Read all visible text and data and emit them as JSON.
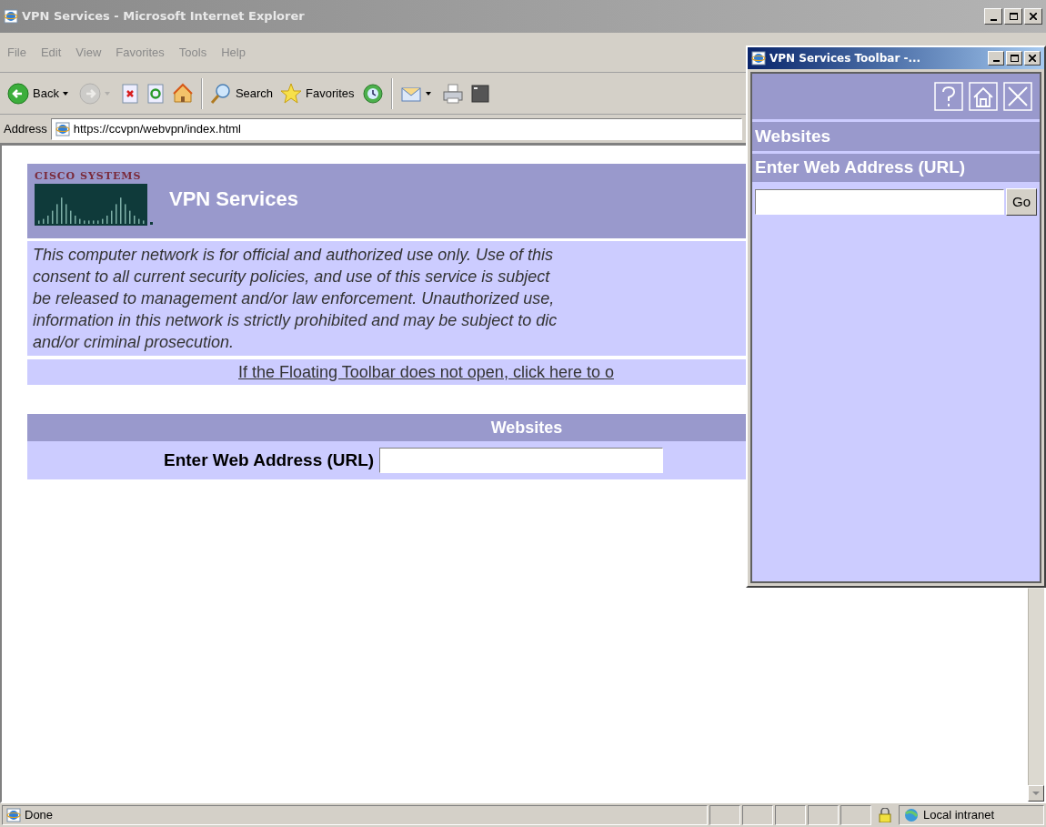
{
  "window": {
    "title": "VPN Services - Microsoft Internet Explorer"
  },
  "menu": [
    "File",
    "Edit",
    "View",
    "Favorites",
    "Tools",
    "Help"
  ],
  "toolbar": [
    {
      "kind": "back",
      "label": "Back",
      "disabled": false
    },
    {
      "kind": "forward",
      "disabled": true
    },
    {
      "kind": "stop",
      "disabled": false
    },
    {
      "kind": "refresh",
      "disabled": false
    },
    {
      "kind": "home",
      "disabled": false
    },
    {
      "kind": "search",
      "label": "Search",
      "disabled": false
    },
    {
      "kind": "favorites",
      "label": "Favorites",
      "disabled": false
    },
    {
      "kind": "media",
      "disabled": false
    },
    {
      "kind": "mail",
      "disabled": false
    },
    {
      "kind": "print",
      "disabled": false
    },
    {
      "kind": "edit",
      "disabled": false
    }
  ],
  "address": {
    "label": "Address",
    "value": "https://ccvpn/webvpn/index.html"
  },
  "page": {
    "logo": "CISCO SYSTEMS",
    "title": "VPN Services",
    "notice": [
      "This computer network is for official and authorized use only. Use of this",
      "consent to all current security policies, and use of this service is subject",
      "be released to management and/or law enforcement. Unauthorized use,",
      "information in this network is strictly prohibited and may be subject to dic",
      "and/or criminal prosecution."
    ],
    "toolbar_link": "If the Floating Toolbar does not open, click here to o",
    "websites": {
      "heading": "Websites",
      "label": "Enter Web Address (URL)"
    }
  },
  "floating_toolbar": {
    "title": "VPN Services Toolbar -...",
    "heading": "Websites",
    "label": "Enter Web Address (URL)",
    "button": "Go"
  },
  "status_bar": {
    "text": "Done",
    "zone": "Local intranet"
  }
}
